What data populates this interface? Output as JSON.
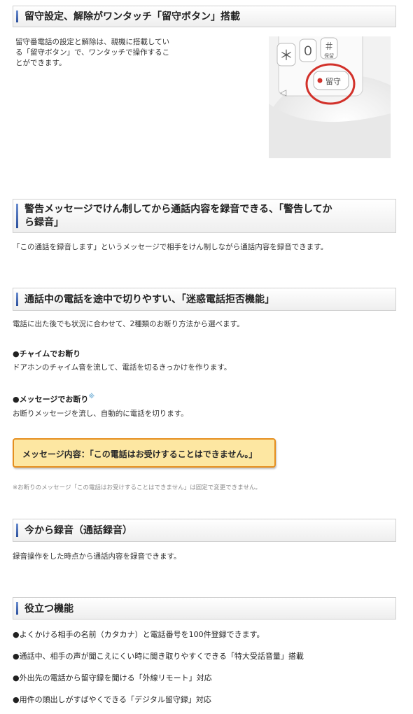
{
  "sections": [
    {
      "title": "留守設定、解除がワンタッチ「留守ボタン」搭載",
      "body": [
        "留守番電話の設定と解除は、親機に搭載してい",
        "る「留守ボタン」で、ワンタッチで操作するこ",
        "とができます。"
      ],
      "photo": {
        "keys": [
          "＊",
          "０",
          "＃"
        ],
        "key_sub": [
          "",
          "",
          "保留"
        ],
        "button_label": "留守",
        "accent": "#d2312a"
      }
    },
    {
      "title_lines": [
        "警告メッセージでけん制してから通話内容を録音できる、「警告してか",
        "ら録音」"
      ],
      "body": "「この通話を録音します」というメッセージで相手をけん制しながら通話内容を録音できます。"
    },
    {
      "title": "通話中の電話を途中で切りやすい、「迷惑電話拒否機能」",
      "body": "電話に出た後でも状況に合わせて、2種類のお断り方法から選べます。",
      "sub1": {
        "head": "●チャイムでお断り",
        "text": "ドアホンのチャイム音を流して、電話を切るきっかけを作ります。"
      },
      "sub2": {
        "head": "●メッセージでお断り",
        "mark": "※",
        "text": "お断りメッセージを流し、自動的に電話を切ります。"
      },
      "message_box": "メッセージ内容：「この電話はお受けすることはできません。」",
      "footnote": "※お断りのメッセージ「この電話はお受けすることはできません」は固定で変更できません。"
    },
    {
      "title": "今から録音（通話録音）",
      "body": "録音操作をした時点から通話内容を録音できます。"
    },
    {
      "title": "役立つ機能",
      "features": [
        "●よくかける相手の名前（カタカナ）と電話番号を100件登録できます。",
        "●通話中、相手の声が聞こえにくい時に聞き取りやすくできる「特大受話音量」搭載",
        "●外出先の電話から留守録を聞ける「外線リモート」対応",
        "●用件の頭出しがすばやくできる「デジタル留守録」対応"
      ]
    }
  ],
  "colors": {
    "header_bar": "#2a4f9c",
    "message_fill": "#fde7a2",
    "message_border": "#e58f1f",
    "note_mark": "#7fb6d9"
  }
}
